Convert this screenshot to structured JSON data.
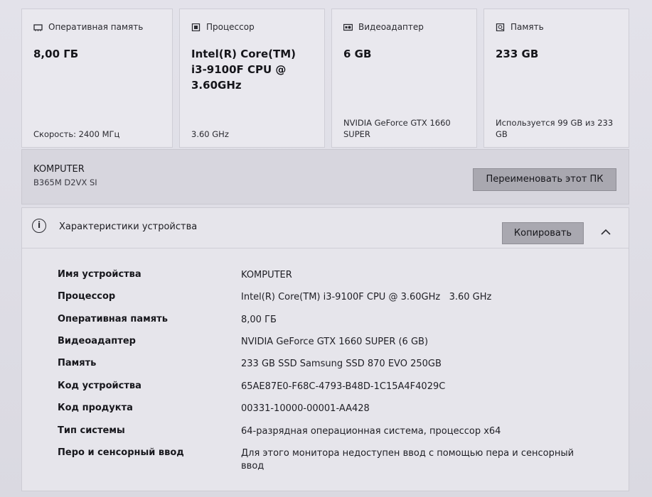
{
  "cards": [
    {
      "icon": "memory-chip-icon",
      "title": "Оперативная память",
      "value": "8,00 ГБ",
      "footer": "Скорость: 2400 МГц"
    },
    {
      "icon": "processor-icon",
      "title": "Процессор",
      "value": "Intel(R) Core(TM) i3-9100F CPU @ 3.60GHz",
      "footer": "3.60 GHz"
    },
    {
      "icon": "graphics-card-icon",
      "title": "Видеоадаптер",
      "value": "6 GB",
      "footer": "NVIDIA GeForce GTX 1660 SUPER"
    },
    {
      "icon": "storage-drive-icon",
      "title": "Память",
      "value": "233 GB",
      "footer": "Используется 99 GB из 233 GB"
    }
  ],
  "pc": {
    "name": "KOMPUTER",
    "model": "B365M D2VX SI",
    "rename_label": "Переименовать этот ПК"
  },
  "specs": {
    "title": "Характеристики устройства",
    "copy_label": "Копировать",
    "rows": [
      {
        "label": "Имя устройства",
        "value": "KOMPUTER"
      },
      {
        "label": "Процессор",
        "value": "Intel(R) Core(TM) i3-9100F CPU @ 3.60GHz   3.60 GHz"
      },
      {
        "label": "Оперативная память",
        "value": "8,00 ГБ"
      },
      {
        "label": "Видеоадаптер",
        "value": "NVIDIA GeForce GTX 1660 SUPER (6 GB)"
      },
      {
        "label": "Память",
        "value": "233 GB SSD Samsung SSD 870 EVO 250GB"
      },
      {
        "label": "Код устройства",
        "value": "65AE87E0-F68C-4793-B48D-1C15A4F4029C"
      },
      {
        "label": "Код продукта",
        "value": "00331-10000-00001-AA428"
      },
      {
        "label": "Тип системы",
        "value": "64-разрядная операционная система, процессор x64"
      },
      {
        "label": "Перо и сенсорный ввод",
        "value": "Для этого монитора недоступен ввод с помощью пера и сенсорный ввод"
      }
    ]
  }
}
